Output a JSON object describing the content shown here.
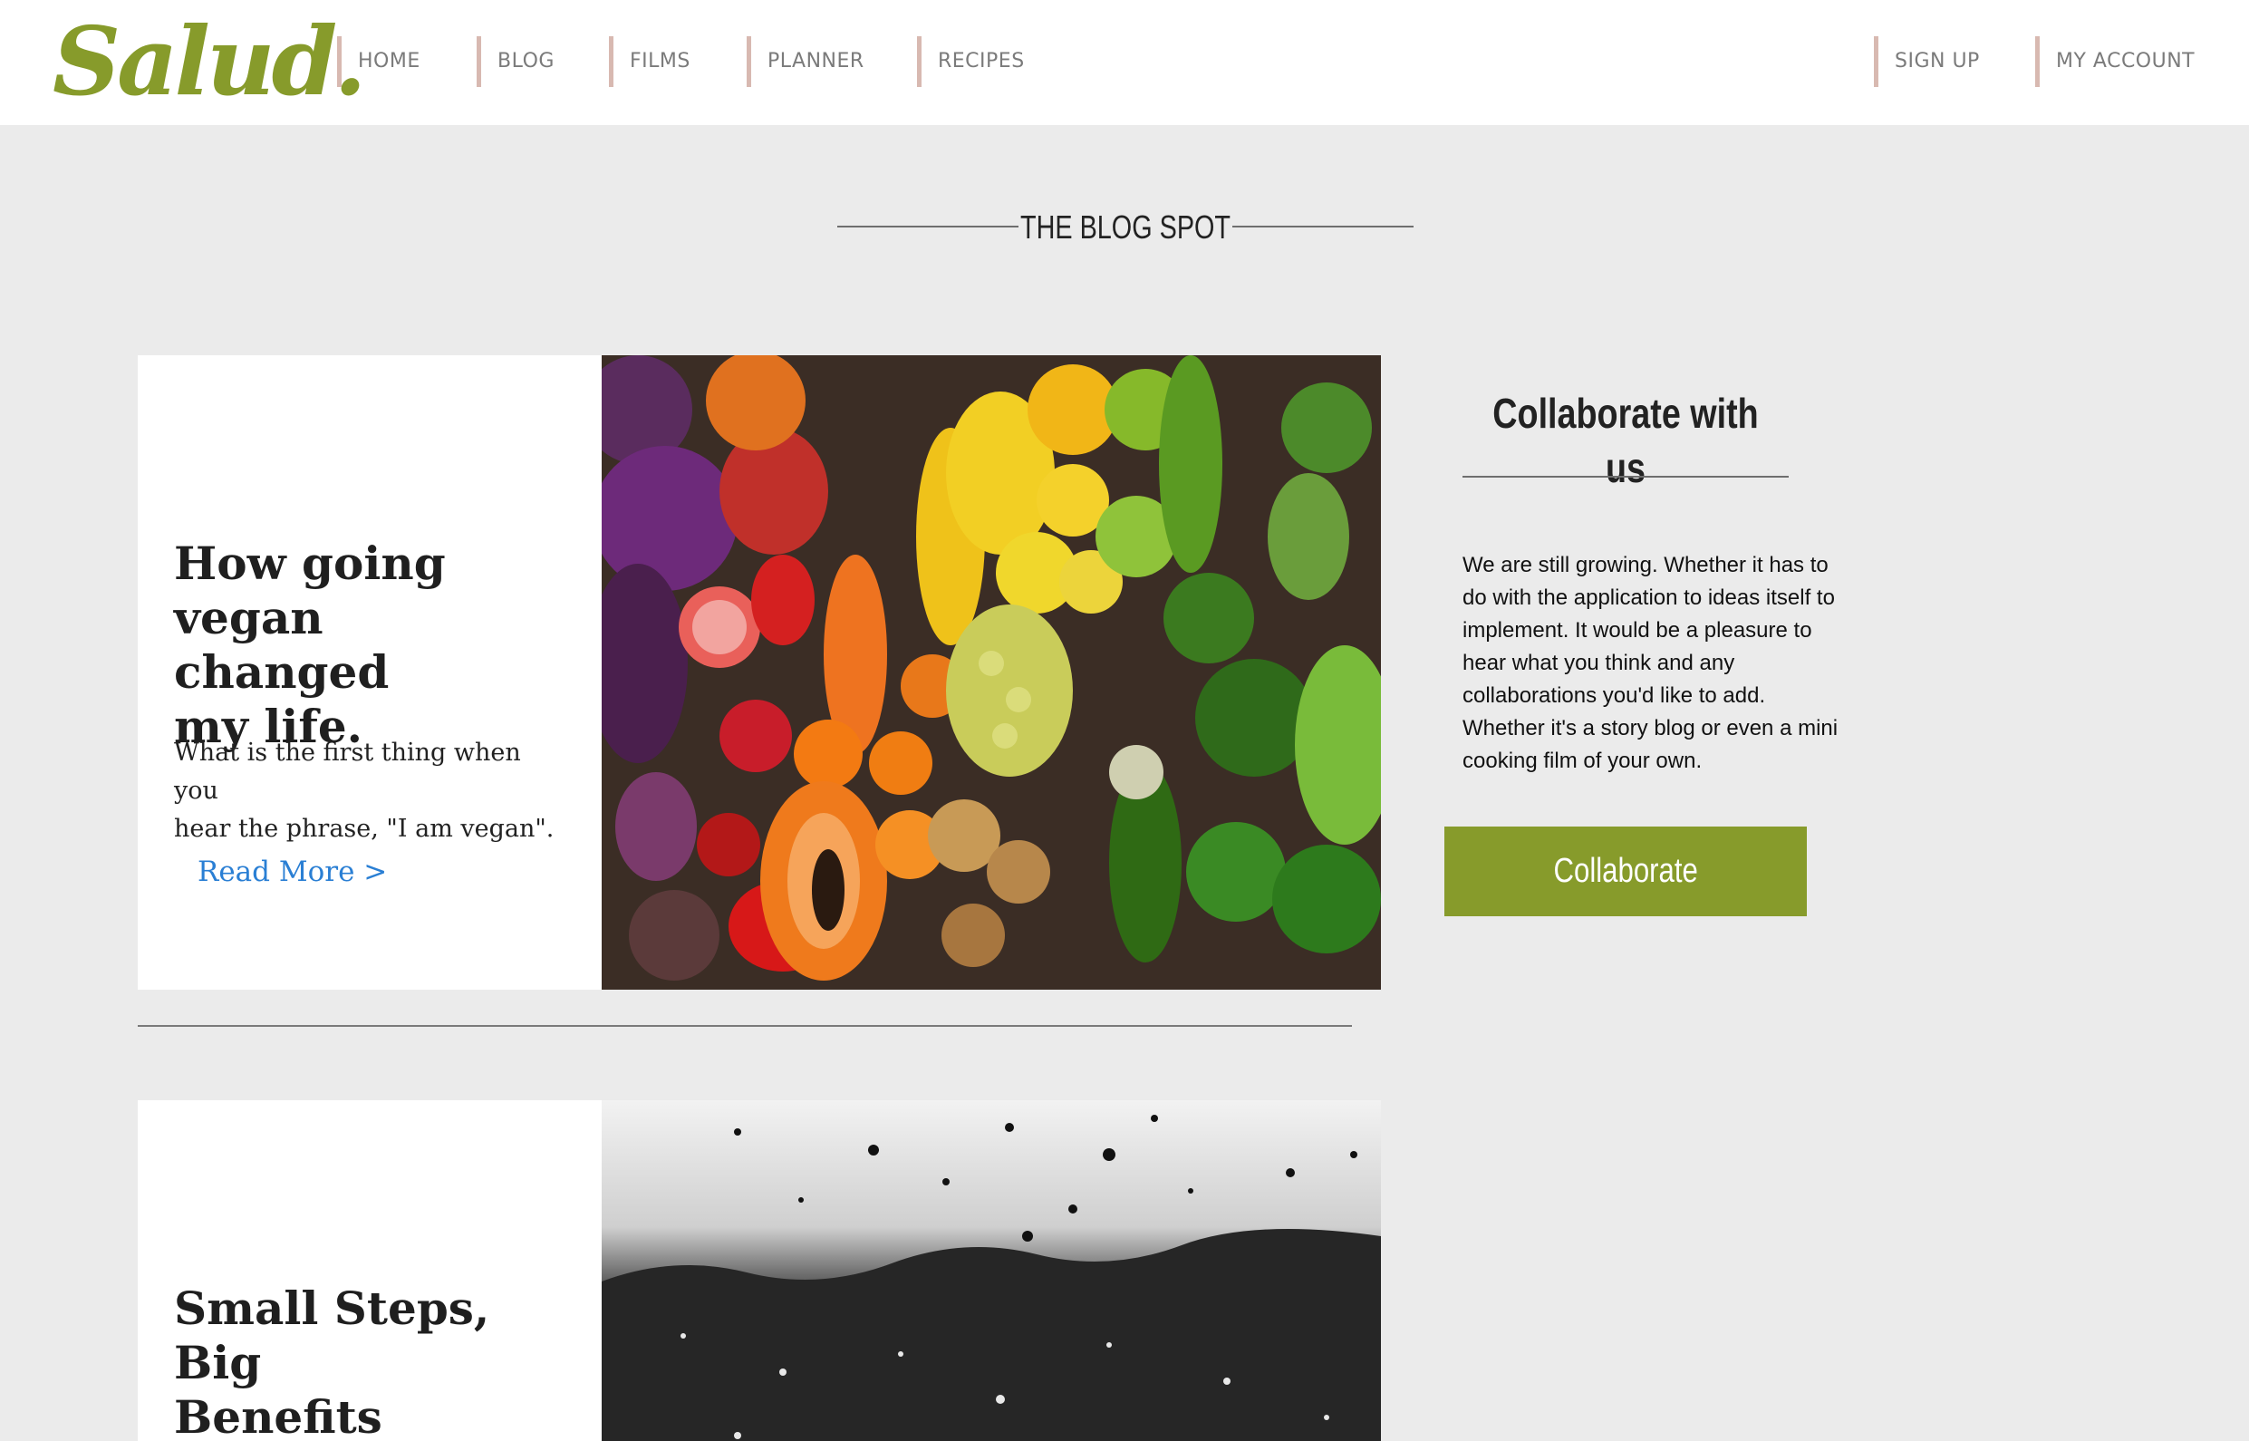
{
  "brand": {
    "logo_text": "Salud.",
    "accent_color": "#879b2b",
    "divider_color": "#d8b9b1",
    "link_color": "#2a7fd4"
  },
  "nav": {
    "left_items": [
      "HOME",
      "BLOG",
      "FILMS",
      "PLANNER",
      "RECIPES"
    ],
    "right_items": [
      "SIGN UP",
      "MY ACCOUNT"
    ]
  },
  "section": {
    "title": "THE BLOG SPOT"
  },
  "posts": [
    {
      "title_lines": [
        "How going vegan",
        "changed",
        "my life."
      ],
      "excerpt_lines": [
        "What is the first thing when you",
        "hear the phrase, \"I am vegan\"."
      ],
      "read_more": "Read More >",
      "image": "vegetables-and-fruits-rainbow"
    },
    {
      "title_lines": [
        "Small Steps, Big",
        "Benefits"
      ],
      "image": "rain-drops-on-window-bw"
    }
  ],
  "sidebar": {
    "title": "Collaborate with us",
    "text_lines": [
      "We are still growing. Whether it has to",
      "do with the application to ideas itself to",
      "implement. It would be a pleasure to",
      "hear what you think and any",
      "collaborations you'd like to add.",
      "Whether it's a story blog or even a mini",
      "cooking film of your own."
    ],
    "button_label": "Collaborate"
  }
}
